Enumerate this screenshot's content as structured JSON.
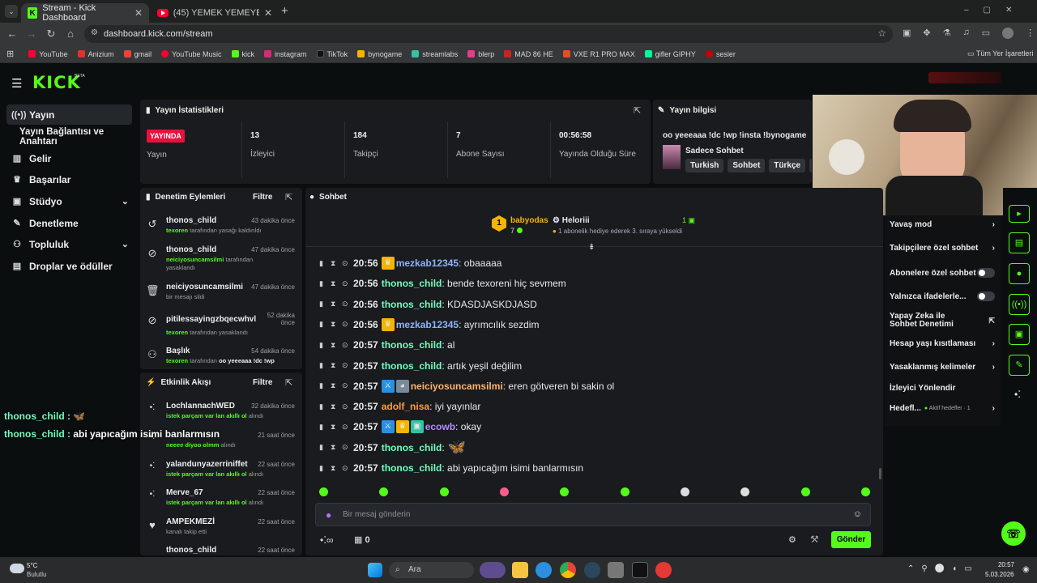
{
  "browser": {
    "tabs": [
      {
        "title": "Stream - Kick Dashboard"
      },
      {
        "title": "(45) YEMEK YEMEYE OTURDUĞ"
      }
    ],
    "url": "dashboard.kick.com/stream",
    "bookmarks": [
      "YouTube",
      "Anizium",
      "gmail",
      "YouTube Music",
      "kick",
      "instagram",
      "TikTok",
      "bynogame",
      "streamlabs",
      "blerp",
      "MAD 86 HE",
      "VXE R1 PRO MAX",
      "gifler GIPHY",
      "sesler"
    ],
    "all_bookmarks": "Tüm Yer İşaretleri"
  },
  "kick": {
    "logo": "KICK",
    "beta": "BETA"
  },
  "sidebar": {
    "items": [
      {
        "label": "Yayın"
      },
      {
        "label": "Yayın Bağlantısı ve Anahtarı"
      },
      {
        "label": "Gelir"
      },
      {
        "label": "Başarılar"
      },
      {
        "label": "Stüdyo"
      },
      {
        "label": "Denetleme"
      },
      {
        "label": "Topluluk"
      },
      {
        "label": "Droplar ve ödüller"
      }
    ]
  },
  "stats": {
    "title": "Yayın İstatistikleri",
    "items": [
      {
        "value": "YAYINDA",
        "label": "Yayın"
      },
      {
        "value": "13",
        "label": "İzleyici"
      },
      {
        "value": "184",
        "label": "Takipçi"
      },
      {
        "value": "7",
        "label": "Abone Sayısı"
      },
      {
        "value": "00:56:58",
        "label": "Yayında Olduğu Süre"
      }
    ]
  },
  "info": {
    "title": "Yayın bilgisi",
    "stream_title": "oo yeeeaaa !dc !wp !insta !bynogame",
    "category": "Sadece Sohbet",
    "tags": [
      "Turkish",
      "Sohbet",
      "Türkçe",
      "ch"
    ]
  },
  "moderation": {
    "title": "Denetim Eylemleri",
    "filter": "Filtre",
    "rows": [
      {
        "name": "thonos_child",
        "time": "43 dakika önce",
        "actor": "texoren",
        "desc": "tarafından yasağı kaldırıldı"
      },
      {
        "name": "thonos_child",
        "time": "47 dakika önce",
        "actor": "neiciyosuncamsilmi",
        "desc": "tarafından yasaklandı"
      },
      {
        "name": "neiciyosuncamsilmi",
        "time": "47 dakika önce",
        "actor": "",
        "desc": "bir mesajı sildi"
      },
      {
        "name": "pitilessayingzbqecwhvl",
        "time": "52 dakika önce",
        "actor": "texoren",
        "desc": "tarafından yasaklandı"
      },
      {
        "name": "Başlık",
        "time": "54 dakika önce",
        "actor": "texoren",
        "desc": "tarafından",
        "extra": "oo yeeeaaa !dc !wp"
      }
    ]
  },
  "activity": {
    "title": "Etkinlik Akışı",
    "filter": "Filtre",
    "rows": [
      {
        "name": "LochlannachWED",
        "time": "32 dakika önce",
        "desc": "istek parçam var lan akıllı ol",
        "suffix": "alındı"
      },
      {
        "name": "",
        "time": "21 saat önce",
        "desc": "neeee diyoo olmm",
        "suffix": "alındı"
      },
      {
        "name": "yalandunyazerriniffet",
        "time": "22 saat önce",
        "desc": "istek parçam var lan akıllı ol",
        "suffix": "alındı"
      },
      {
        "name": "Merve_67",
        "time": "22 saat önce",
        "desc": "istek parçam var lan akıllı ol",
        "suffix": "alındı"
      },
      {
        "name": "AMPEKMEZİ",
        "time": "22 saat önce",
        "desc": "kanalı takip etti",
        "suffix": ""
      },
      {
        "name": "thonos_child",
        "time": "22 saat önce",
        "desc": "",
        "suffix": ""
      }
    ]
  },
  "overlay": [
    {
      "user": "thonos_child :",
      "msg": ""
    },
    {
      "user": "thonos_child :",
      "msg": "abi yapıcağım isimi banlarmısın"
    }
  ],
  "chat": {
    "title": "Sohbet",
    "top_user": "babyodas",
    "top_count": "7",
    "gifter": "Heloriii",
    "gift_count": "1",
    "gift_text": "1 abonelik hediye ederek 3. sıraya yükseldi",
    "messages": [
      {
        "time": "20:56",
        "user": "mezkab12345",
        "color": "#8eb3ff",
        "text": ": obaaaaa",
        "badges": [
          "crown"
        ]
      },
      {
        "time": "20:56",
        "user": "thonos_child",
        "color": "#75fdbd",
        "text": ": bende texoreni hiç sevmem",
        "badges": []
      },
      {
        "time": "20:56",
        "user": "thonos_child",
        "color": "#75fdbd",
        "text": ": KDASDJASKDJASD",
        "badges": []
      },
      {
        "time": "20:56",
        "user": "mezkab12345",
        "color": "#8eb3ff",
        "text": ": ayrımcılık sezdim",
        "badges": [
          "crown"
        ]
      },
      {
        "time": "20:57",
        "user": "thonos_child",
        "color": "#75fdbd",
        "text": ": al",
        "badges": []
      },
      {
        "time": "20:57",
        "user": "thonos_child",
        "color": "#75fdbd",
        "text": ": artık yeşil değilim",
        "badges": []
      },
      {
        "time": "20:57",
        "user": "neiciyosuncamsilmi",
        "color": "#ffb46b",
        "text": ": eren götveren bi sakin ol",
        "badges": [
          "sword",
          "avatar"
        ]
      },
      {
        "time": "20:57",
        "user": "adolf_nisa",
        "color": "#ff9d3a",
        "text": ": iyi yayınlar",
        "badges": []
      },
      {
        "time": "20:57",
        "user": "ecowb",
        "color": "#b58cff",
        "text": ": okay",
        "badges": [
          "sword",
          "crown",
          "gift"
        ]
      },
      {
        "time": "20:57",
        "user": "thonos_child",
        "color": "#75fdbd",
        "text": ":",
        "badges": []
      },
      {
        "time": "20:57",
        "user": "thonos_child",
        "color": "#75fdbd",
        "text": ": abi yapıcağım isimi banlarmısın",
        "badges": []
      }
    ],
    "input_placeholder": "Bir mesaj gönderin",
    "points": "0",
    "send": "Gönder"
  },
  "settings": {
    "rows": [
      {
        "label": "Yavaş mod",
        "type": "chev"
      },
      {
        "label": "Takipçilere özel sohbet",
        "type": "chev"
      },
      {
        "label": "Abonelere özel sohbet",
        "type": "toggle"
      },
      {
        "label": "Yalnızca ifadelerle...",
        "type": "toggle"
      },
      {
        "label": "Yapay Zeka ile Sohbet Denetimi",
        "type": "link"
      },
      {
        "label": "Hesap yaşı kısıtlaması",
        "type": "chev"
      },
      {
        "label": "Yasaklanmış kelimeler",
        "type": "chev"
      },
      {
        "label": "İzleyici Yönlendir",
        "type": "none"
      },
      {
        "label": "Hedefl...",
        "type": "chev",
        "extra": "Aktif hedefler · 1"
      }
    ]
  },
  "taskbar": {
    "weather_temp": "5°C",
    "weather_desc": "Bulutlu",
    "search": "Ara",
    "time": "20:57",
    "date": "5.03.2026"
  }
}
